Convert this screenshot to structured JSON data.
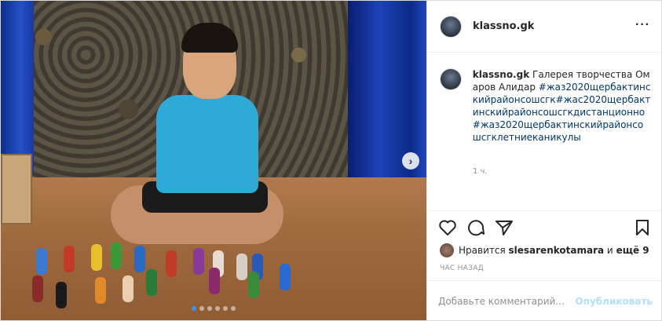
{
  "post": {
    "username": "klassno.gk",
    "more_icon": "more-horizontal-icon",
    "caption_text": "Галерея творчества Омаров Алидар",
    "hashtags": "#жаз2020щербактинскийрайонсошсгк#жас2020щербактинскийрайонсошсгкдистанционно#жаз2020щербактинскийрайонсошсгклетниеканикулы",
    "time_label": "1 ч.",
    "likes_prefix": "Нравится",
    "likes_user": "slesarenkotamara",
    "likes_suffix_and": "и",
    "likes_others": "ещё 9",
    "ago_label": "ЧАС НАЗАД",
    "comment_placeholder": "Добавьте комментарий...",
    "publish_label": "Опубликовать"
  },
  "carousel": {
    "total_slides": 6,
    "active_index": 0,
    "next_icon": "chevron-right-icon"
  },
  "actions": {
    "like_icon": "heart-icon",
    "comment_icon": "comment-icon",
    "share_icon": "send-icon",
    "save_icon": "bookmark-icon"
  }
}
